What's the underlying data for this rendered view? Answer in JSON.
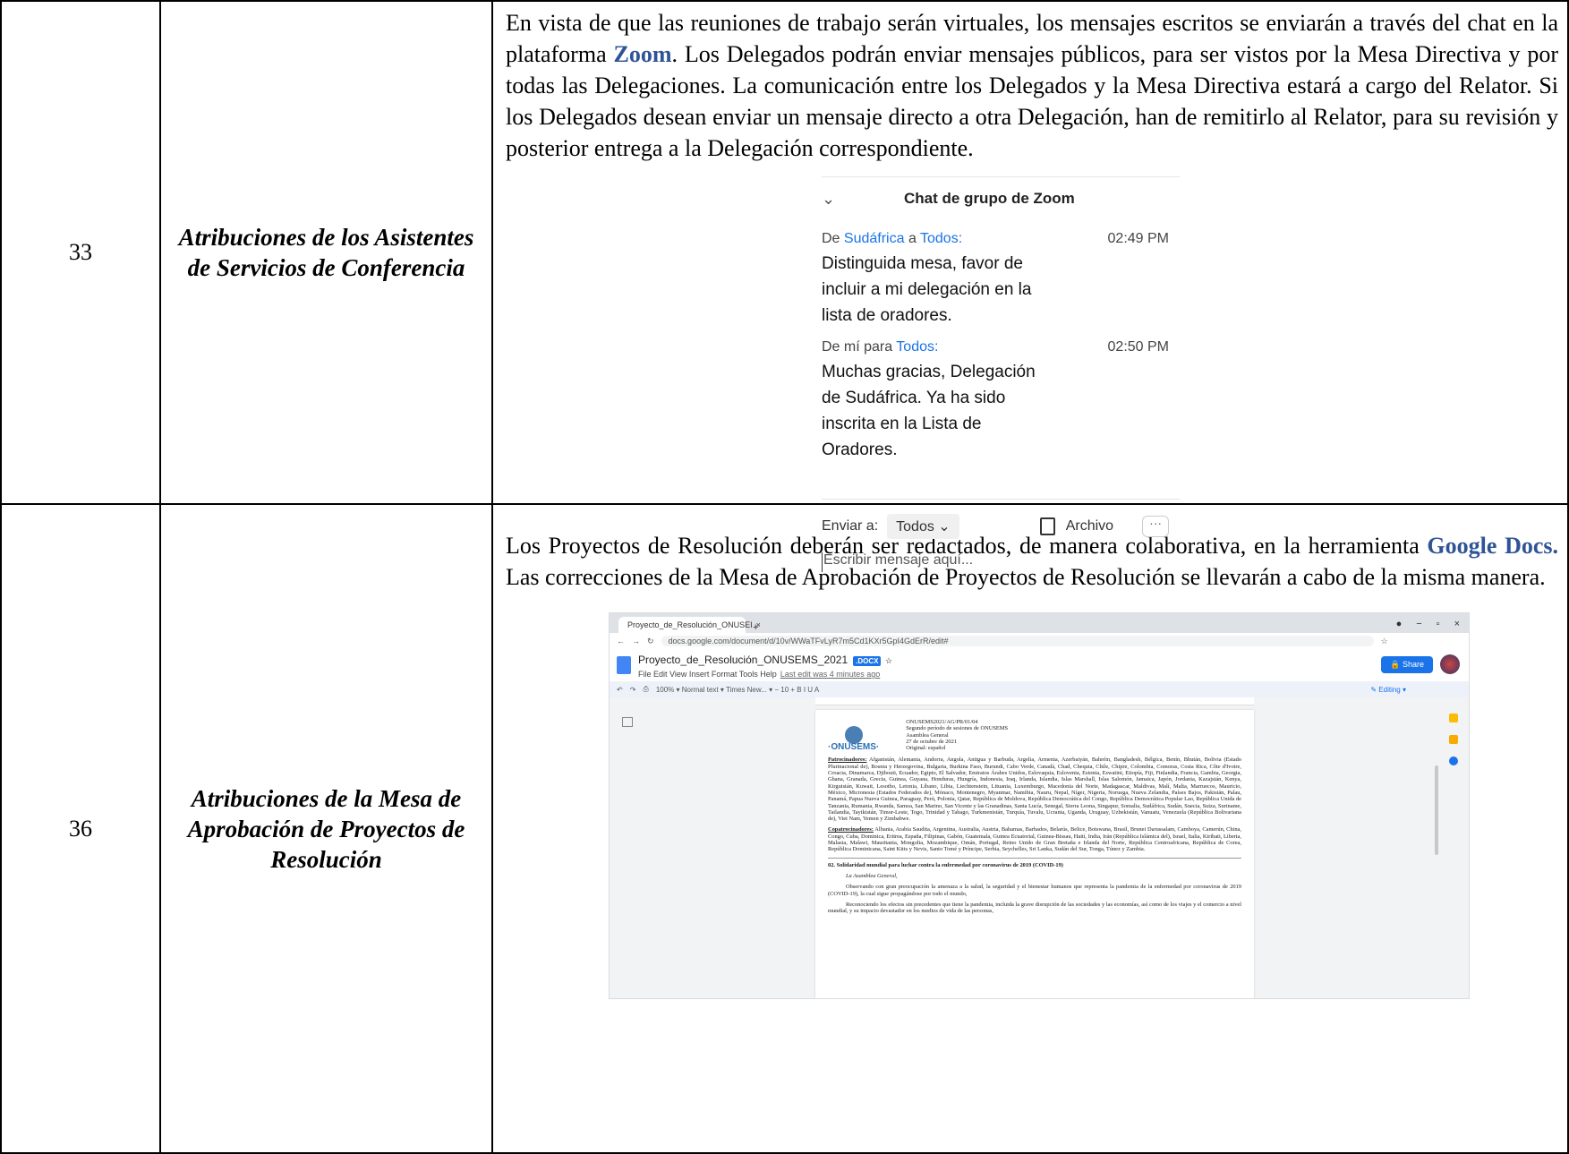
{
  "rows": [
    {
      "number": "33",
      "title": "Atribuciones de los Asistentes de Servicios de Conferencia",
      "text_before": "En vista de que las reuniones de trabajo serán virtuales, los mensajes escritos se enviarán a través del chat en la plataforma ",
      "highlight": "Zoom",
      "text_after": ".  Los Delegados podrán enviar mensajes públicos, para ser vistos por la Mesa Directiva y por todas las Delegaciones. La comunicación entre los Delegados y la Mesa Directiva estará a cargo del Relator.  Si los Delegados desean enviar un mensaje directo a otra Delegación, han de remitirlo al Relator, para su revisión y posterior entrega a la Delegación correspondiente."
    },
    {
      "number": "36",
      "title": "Atribuciones de la Mesa de Aprobación de Proyectos de Resolución",
      "text_before": "Los Proyectos de Resolución deberán ser redactados, de manera colaborativa, en la herramienta ",
      "highlight": "Google Docs.",
      "text_after": "  Las correcciones de la Mesa de Aprobación de Proyectos de Resolución se llevarán a cabo de la misma manera."
    }
  ],
  "zoom_chat": {
    "title": "Chat de grupo de Zoom",
    "messages": [
      {
        "from_prefix": "De ",
        "from": "Sudáfrica",
        "mid": " a ",
        "to": "Todos:",
        "time": "02:49 PM",
        "body": "Distinguida mesa, favor de incluir a mi delegación en la lista de oradores."
      },
      {
        "from_prefix": "De mí para ",
        "from": "",
        "mid": "",
        "to": "Todos:",
        "time": "02:50 PM",
        "body": "Muchas gracias, Delegación de Sudáfrica.  Ya ha sido inscrita en la Lista de Oradores."
      }
    ],
    "send_to_label": "Enviar a:",
    "send_to_value": "Todos",
    "file_label": "Archivo",
    "more_label": "···",
    "input_placeholder": "Escribir mensaje aquí..."
  },
  "gdoc": {
    "tab_title": "Proyecto_de_Resolución_ONUSEI",
    "url": "docs.google.com/document/d/10v/WWaTFvLyR7m5Cd1KXr5GpI4GdErR/edit#",
    "doc_title": "Proyecto_de_Resolución_ONUSEMS_2021",
    "badge": ".DOCX",
    "menus": "File  Edit  View  Insert  Format  Tools  Help",
    "last_edit": "Last edit was 4 minutes ago",
    "share": "Share",
    "toolbar": "100%  ▾   Normal text  ▾   Times New...  ▾   −  10  +   B  I  U  A",
    "editing": "Editing",
    "page_header": "ONUSEMS2021/AG/PR/01/04\nSegundo período de sesiones de ONUSEMS\nAsamblea General\n27 de octubre de 2021\nOriginal: español",
    "logo_text": "·ONUSEMS·",
    "patrocinadores_label": "Patrocinadores:",
    "patrocinadores": "Afganistán, Alemania, Andorra, Angola, Antigua y Barbuda, Argelia, Armenia, Azerbaiyán, Bahréin, Bangladesh, Bélgica, Benín, Bhután, Bolivia (Estado Plurinacional de), Bosnia y Herzegovina, Bulgaria, Burkina Faso, Burundi, Cabo Verde, Canadá, Chad, Chequia, Chile, Chipre, Colombia, Comoras, Costa Rica, Côte d'Ivoire, Croacia, Dinamarca, Djibouti, Ecuador, Egipto, El Salvador, Emiratos Árabes Unidos, Eslovaquia, Eslovenia, Estonia, Eswatini, Etiopía, Fiji, Finlandia, Francia, Gambia, Georgia, Ghana, Granada, Grecia, Guinea, Guyana, Honduras, Hungría, Indonesia, Iraq, Irlanda, Islandia, Islas Marshall, Islas Salomón, Jamaica, Japón, Jordania, Kazajstán, Kenya, Kirguistán, Kuwait, Lesotho, Letonia, Líbano, Libia, Liechtenstein, Lituania, Luxemburgo, Macedonia del Norte, Madagascar, Maldivas, Malí, Malta, Marruecos, Mauricio, México, Micronesia (Estados Federados de), Mónaco, Montenegro, Myanmar, Namibia, Nauru, Nepal, Níger, Nigeria, Noruega, Nueva Zelandia, Países Bajos, Pakistán, Palau, Panamá, Papua Nueva Guinea, Paraguay, Perú, Polonia, Qatar, República de Moldova, República Democrática del Congo, República Democrática Popular Lao, República Unida de Tanzania, Rumania, Rwanda, Samoa, San Marino, San Vicente y las Granadinas, Santa Lucía, Senegal, Sierra Leona, Singapur, Somalia, Sudáfrica, Sudán, Suecia, Suiza, Suriname, Tailandia, Tayikistán, Timor-Leste, Togo, Trinidad y Tabago, Turkmenistán, Turquía, Tuvalu, Ucrania, Uganda, Uruguay, Uzbekistán, Vanuatu, Venezuela (República Bolivariana de), Viet Nam, Yemen y Zimbabwe.",
    "copatrocinadores_label": "Copatrocinadores:",
    "copatrocinadores": "Albania, Arabia Saudita, Argentina, Australia, Austria, Bahamas, Barbados, Belarús, Belice, Botswana, Brasil, Brunei Darussalam, Camboya, Camerún, China, Congo, Cuba, Dominica, Eritrea, España, Filipinas, Gabón, Guatemala, Guinea Ecuatorial, Guinea-Bissau, Haití, India, Irán (República Islámica del), Israel, Italia, Kiribati, Liberia, Malasia, Malawi, Mauritania, Mongolia, Mozambique, Omán, Portugal, Reino Unido de Gran Bretaña e Irlanda del Norte, República Centroafricana, República de Corea, República Dominicana, Saint Kitts y Nevis, Santo Tomé y Príncipe, Serbia, Seychelles, Sri Lanka, Sudán del Sur, Tonga, Túnez y Zambia.",
    "resolution_title": "02. Solidaridad mundial para luchar contra la enfermedad por coronavirus de 2019 (COVID-19)",
    "assembly": "La Asamblea General,",
    "para1": "Observando con gran preocupación la amenaza a la salud, la seguridad y el bienestar humanos que representa la pandemia de la enfermedad por coronavirus de 2019 (COVID-19), la cual sigue propagándose por todo el mundo,",
    "para2": "Reconociendo los efectos sin precedentes que tiene la pandemia, incluida la grave disrupción de las sociedades y las economías, así como de los viajes y el comercio a nivel mundial, y su impacto devastador en los medios de vida de las personas,"
  }
}
